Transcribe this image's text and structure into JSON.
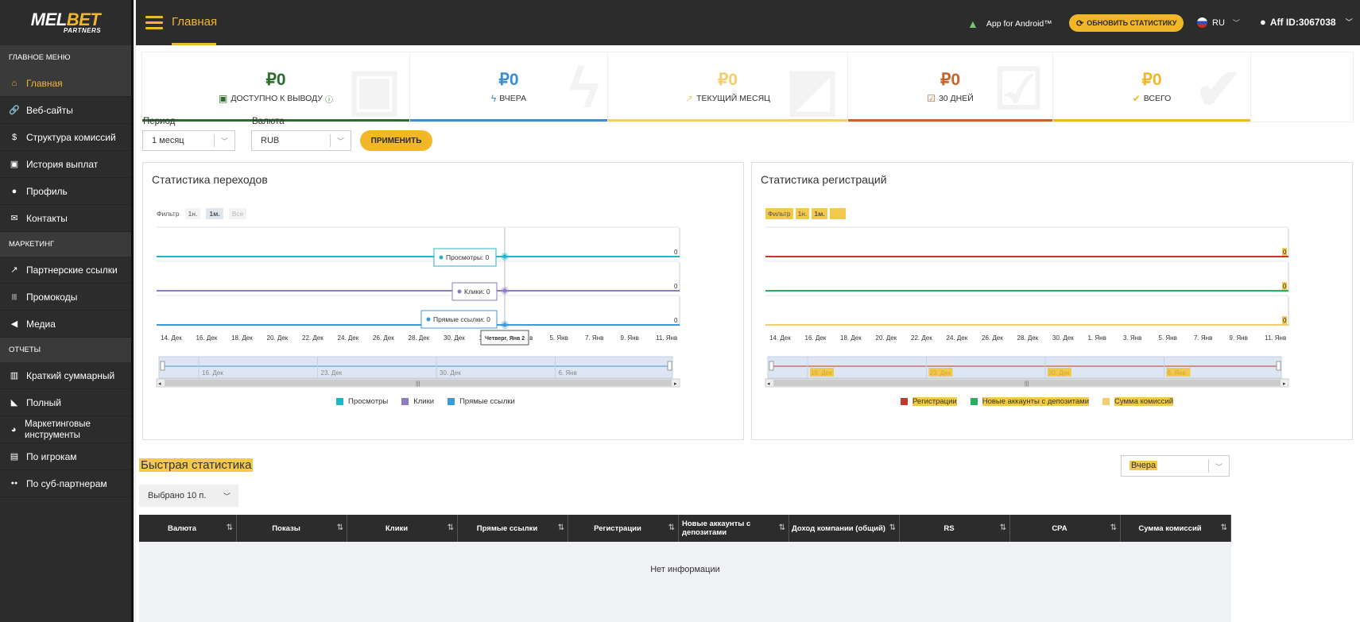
{
  "brand": {
    "logo_prefix": "MEL",
    "logo_suffix": "BET",
    "logo_sub": "PARTNERS"
  },
  "sidebar": {
    "sections": [
      {
        "label": "ГЛАВНОЕ МЕНЮ",
        "items": [
          {
            "label": "Главная",
            "icon": "home-icon",
            "active": true
          },
          {
            "label": "Веб-сайты",
            "icon": "link-icon"
          },
          {
            "label": "Структура комиссий",
            "icon": "dollar-icon"
          },
          {
            "label": "История выплат",
            "icon": "money-icon"
          },
          {
            "label": "Профиль",
            "icon": "user-icon"
          },
          {
            "label": "Контакты",
            "icon": "mail-icon"
          }
        ]
      },
      {
        "label": "МАРКЕТИНГ",
        "items": [
          {
            "label": "Партнерские ссылки",
            "icon": "external-link-icon"
          },
          {
            "label": "Промокоды",
            "icon": "barcode-icon"
          },
          {
            "label": "Медиа",
            "icon": "megaphone-icon"
          }
        ]
      },
      {
        "label": "ОТЧЕТЫ",
        "items": [
          {
            "label": "Краткий суммарный",
            "icon": "bar-chart-icon"
          },
          {
            "label": "Полный",
            "icon": "area-chart-icon"
          },
          {
            "label": "Маркетинговые инструменты",
            "icon": "palette-icon"
          },
          {
            "label": "По игрокам",
            "icon": "id-card-icon"
          },
          {
            "label": "По суб-партнерам",
            "icon": "users-icon"
          }
        ]
      }
    ]
  },
  "header": {
    "title": "Главная",
    "android_label": "App for Android™",
    "refresh_label": "ОБНОВИТЬ СТАТИСТИКУ",
    "lang": "RU",
    "aff_id": "Aff ID:3067038"
  },
  "cards": [
    {
      "amount": "₽0",
      "label": "ДОСТУПНО К ВЫВОДУ",
      "color": "#2e6b2e",
      "icon": "cash-icon"
    },
    {
      "amount": "₽0",
      "label": "ВЧЕРА",
      "color": "#3b8fd0",
      "icon": "bolt-icon"
    },
    {
      "amount": "₽0",
      "label": "ТЕКУЩИЙ МЕСЯЦ",
      "color": "#f2cf6e",
      "icon": "trend-icon"
    },
    {
      "amount": "₽0",
      "label": "30 ДНЕЙ",
      "color": "#c9632c",
      "icon": "calendar-check-icon"
    },
    {
      "amount": "₽0",
      "label": "ВСЕГО",
      "color": "#f2b728",
      "icon": "check-icon"
    }
  ],
  "filters": {
    "period_label": "Период",
    "period_value": "1 месяц",
    "currency_label": "Валюта",
    "currency_value": "RUB",
    "apply_label": "ПРИМЕНИТЬ"
  },
  "transitions": {
    "title": "Статистика переходов",
    "filter_label": "Фильтр",
    "filter_options": [
      "1н.",
      "1м.",
      "Все"
    ],
    "tooltips": [
      "Просмотры: 0",
      "Клики: 0",
      "Прямые ссылки: 0"
    ],
    "date_tooltip": "Четверг, Янв 2",
    "end_values": [
      "0",
      "0",
      "0"
    ],
    "navigator_labels": [
      "16. Дек",
      "23. Дек",
      "30. Дек",
      "6. Янв"
    ],
    "legend": [
      "Просмотры",
      "Клики",
      "Прямые ссылки"
    ]
  },
  "registrations": {
    "title": "Статистика регистраций",
    "filter_label": "Фильтр",
    "filter_options": [
      "1н.",
      "1м.",
      "Все"
    ],
    "end_values": [
      "0",
      "0",
      "0"
    ],
    "navigator_labels": [
      "16. Дек",
      "23. Дек",
      "30. Дек",
      "6. Янв"
    ],
    "legend": [
      "Регистрации",
      "Новые аккаунты с депозитами",
      "Сумма комиссий"
    ]
  },
  "chart_data": [
    {
      "type": "line",
      "title": "Статистика переходов",
      "x": [
        "14. Дек",
        "16. Дек",
        "18. Дек",
        "20. Дек",
        "22. Дек",
        "24. Дек",
        "26. Дек",
        "28. Дек",
        "30. Дек",
        "1. Янв",
        "3. Янв",
        "5. Янв",
        "7. Янв",
        "9. Янв",
        "11. Янв"
      ],
      "series": [
        {
          "name": "Просмотры",
          "color": "#1fb6c9",
          "values": [
            0,
            0,
            0,
            0,
            0,
            0,
            0,
            0,
            0,
            0,
            0,
            0,
            0,
            0,
            0
          ]
        },
        {
          "name": "Клики",
          "color": "#8e7cc3",
          "values": [
            0,
            0,
            0,
            0,
            0,
            0,
            0,
            0,
            0,
            0,
            0,
            0,
            0,
            0,
            0
          ]
        },
        {
          "name": "Прямые ссылки",
          "color": "#3d9ad8",
          "values": [
            0,
            0,
            0,
            0,
            0,
            0,
            0,
            0,
            0,
            0,
            0,
            0,
            0,
            0,
            0
          ]
        }
      ]
    },
    {
      "type": "line",
      "title": "Статистика регистраций",
      "x": [
        "14. Дек",
        "16. Дек",
        "18. Дек",
        "20. Дек",
        "22. Дек",
        "24. Дек",
        "26. Дек",
        "28. Дек",
        "30. Дек",
        "1. Янв",
        "3. Янв",
        "5. Янв",
        "7. Янв",
        "9. Янв",
        "11. Янв"
      ],
      "series": [
        {
          "name": "Регистрации",
          "color": "#c0392b",
          "values": [
            0,
            0,
            0,
            0,
            0,
            0,
            0,
            0,
            0,
            0,
            0,
            0,
            0,
            0,
            0
          ]
        },
        {
          "name": "Новые аккаунты с депозитами",
          "color": "#27ae60",
          "values": [
            0,
            0,
            0,
            0,
            0,
            0,
            0,
            0,
            0,
            0,
            0,
            0,
            0,
            0,
            0
          ]
        },
        {
          "name": "Сумма комиссий",
          "color": "#f2cf6e",
          "values": [
            0,
            0,
            0,
            0,
            0,
            0,
            0,
            0,
            0,
            0,
            0,
            0,
            0,
            0,
            0
          ]
        }
      ]
    }
  ],
  "quick_stats": {
    "title": "Быстрая статистика",
    "period_value": "Вчера",
    "chosen_label": "Выбрано 10 п.",
    "columns": [
      "Валюта",
      "Показы",
      "Клики",
      "Прямые ссылки",
      "Регистрации",
      "Новые аккаунты с депозитами",
      "Доход компании (общий)",
      "RS",
      "CPA",
      "Сумма комиссий"
    ],
    "empty_text": "Нет информации"
  }
}
